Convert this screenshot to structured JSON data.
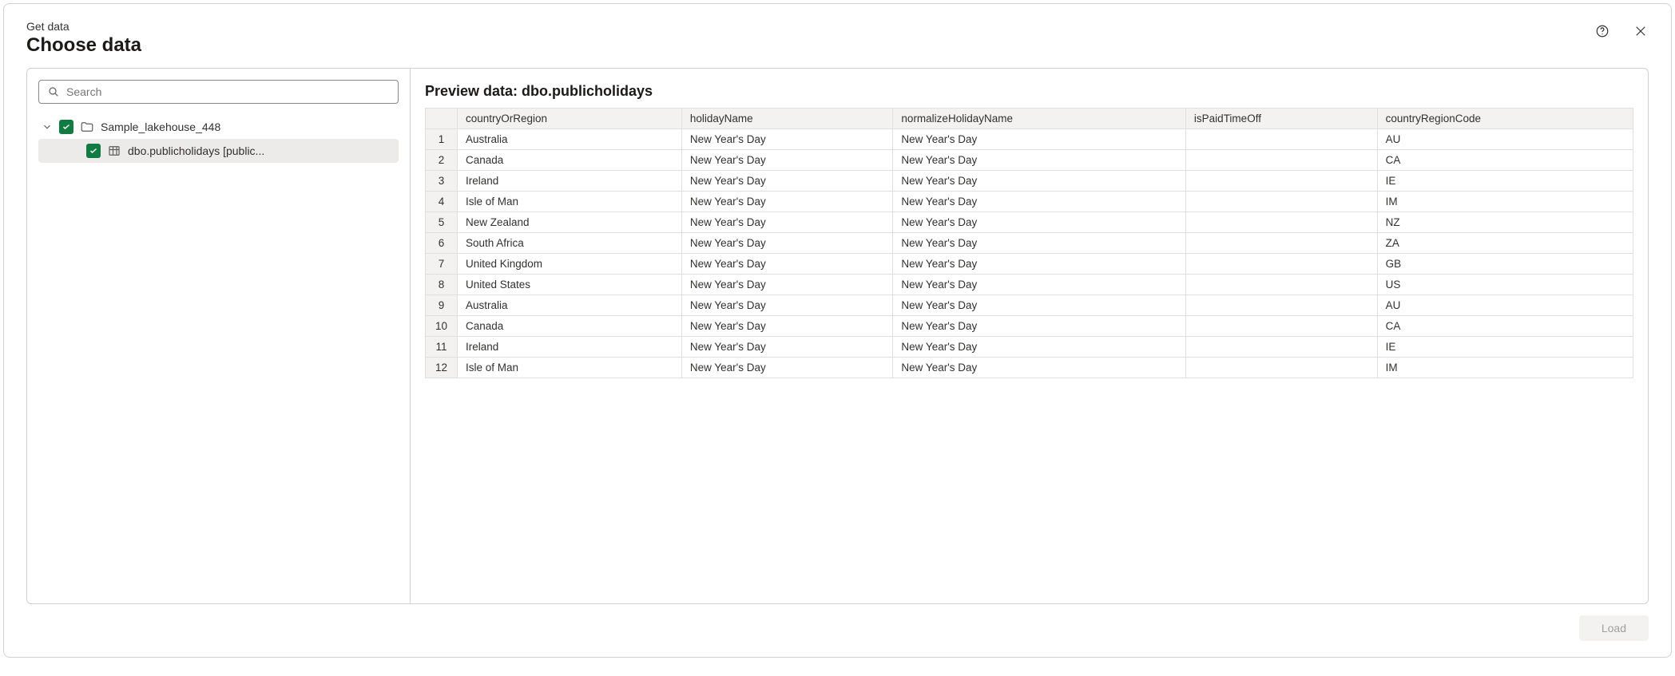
{
  "breadcrumb": "Get data",
  "title": "Choose data",
  "search": {
    "placeholder": "Search"
  },
  "tree": {
    "root_label": "Sample_lakehouse_448",
    "child_label": "dbo.publicholidays [public..."
  },
  "preview": {
    "title": "Preview data: dbo.publicholidays",
    "columns": [
      "countryOrRegion",
      "holidayName",
      "normalizeHolidayName",
      "isPaidTimeOff",
      "countryRegionCode"
    ],
    "rows": [
      [
        "Australia",
        "New Year's Day",
        "New Year's Day",
        "",
        "AU"
      ],
      [
        "Canada",
        "New Year's Day",
        "New Year's Day",
        "",
        "CA"
      ],
      [
        "Ireland",
        "New Year's Day",
        "New Year's Day",
        "",
        "IE"
      ],
      [
        "Isle of Man",
        "New Year's Day",
        "New Year's Day",
        "",
        "IM"
      ],
      [
        "New Zealand",
        "New Year's Day",
        "New Year's Day",
        "",
        "NZ"
      ],
      [
        "South Africa",
        "New Year's Day",
        "New Year's Day",
        "",
        "ZA"
      ],
      [
        "United Kingdom",
        "New Year's Day",
        "New Year's Day",
        "",
        "GB"
      ],
      [
        "United States",
        "New Year's Day",
        "New Year's Day",
        "",
        "US"
      ],
      [
        "Australia",
        "New Year's Day",
        "New Year's Day",
        "",
        "AU"
      ],
      [
        "Canada",
        "New Year's Day",
        "New Year's Day",
        "",
        "CA"
      ],
      [
        "Ireland",
        "New Year's Day",
        "New Year's Day",
        "",
        "IE"
      ],
      [
        "Isle of Man",
        "New Year's Day",
        "New Year's Day",
        "",
        "IM"
      ]
    ]
  },
  "footer": {
    "load_label": "Load"
  }
}
